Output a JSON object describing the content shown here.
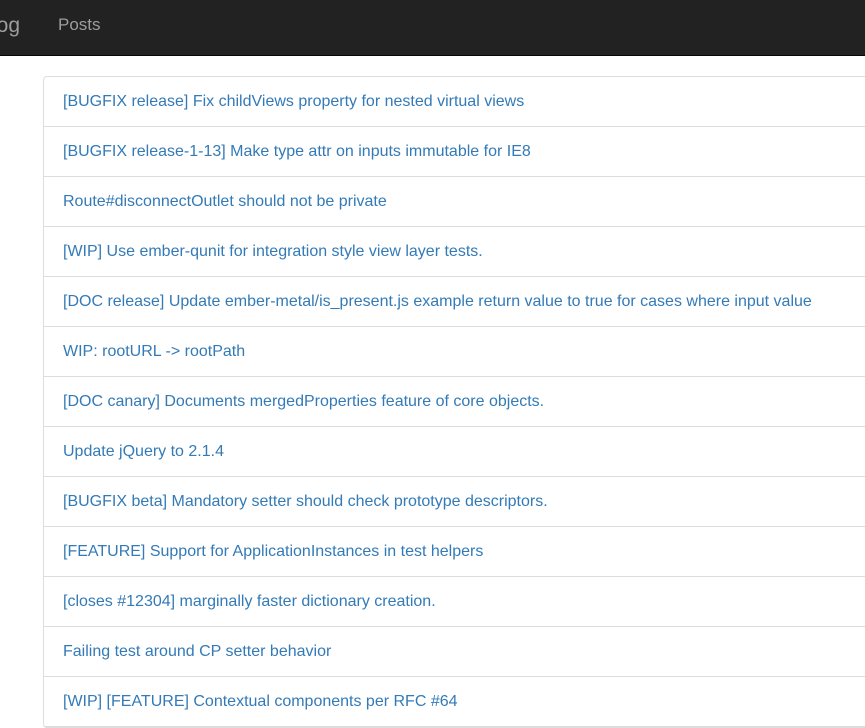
{
  "navbar": {
    "brand": "Blog",
    "links": [
      "Posts"
    ]
  },
  "posts": [
    "[BUGFIX release] Fix childViews property for nested virtual views",
    "[BUGFIX release-1-13] Make type attr on inputs immutable for IE8",
    "Route#disconnectOutlet should not be private",
    "[WIP] Use ember-qunit for integration style view layer tests.",
    "[DOC release] Update ember-metal/is_present.js example return value to true for cases where input value",
    "WIP: rootURL -> rootPath",
    "[DOC canary] Documents mergedProperties feature of core objects.",
    "Update jQuery to 2.1.4",
    "[BUGFIX beta] Mandatory setter should check prototype descriptors.",
    "[FEATURE] Support for ApplicationInstances in test helpers",
    "[closes #12304] marginally faster dictionary creation.",
    "Failing test around CP setter behavior",
    "[WIP] [FEATURE] Contextual components per RFC #64"
  ],
  "colors": {
    "navbar_bg": "#222222",
    "navbar_text": "#9d9d9d",
    "link": "#337ab7",
    "border": "#dddddd"
  }
}
